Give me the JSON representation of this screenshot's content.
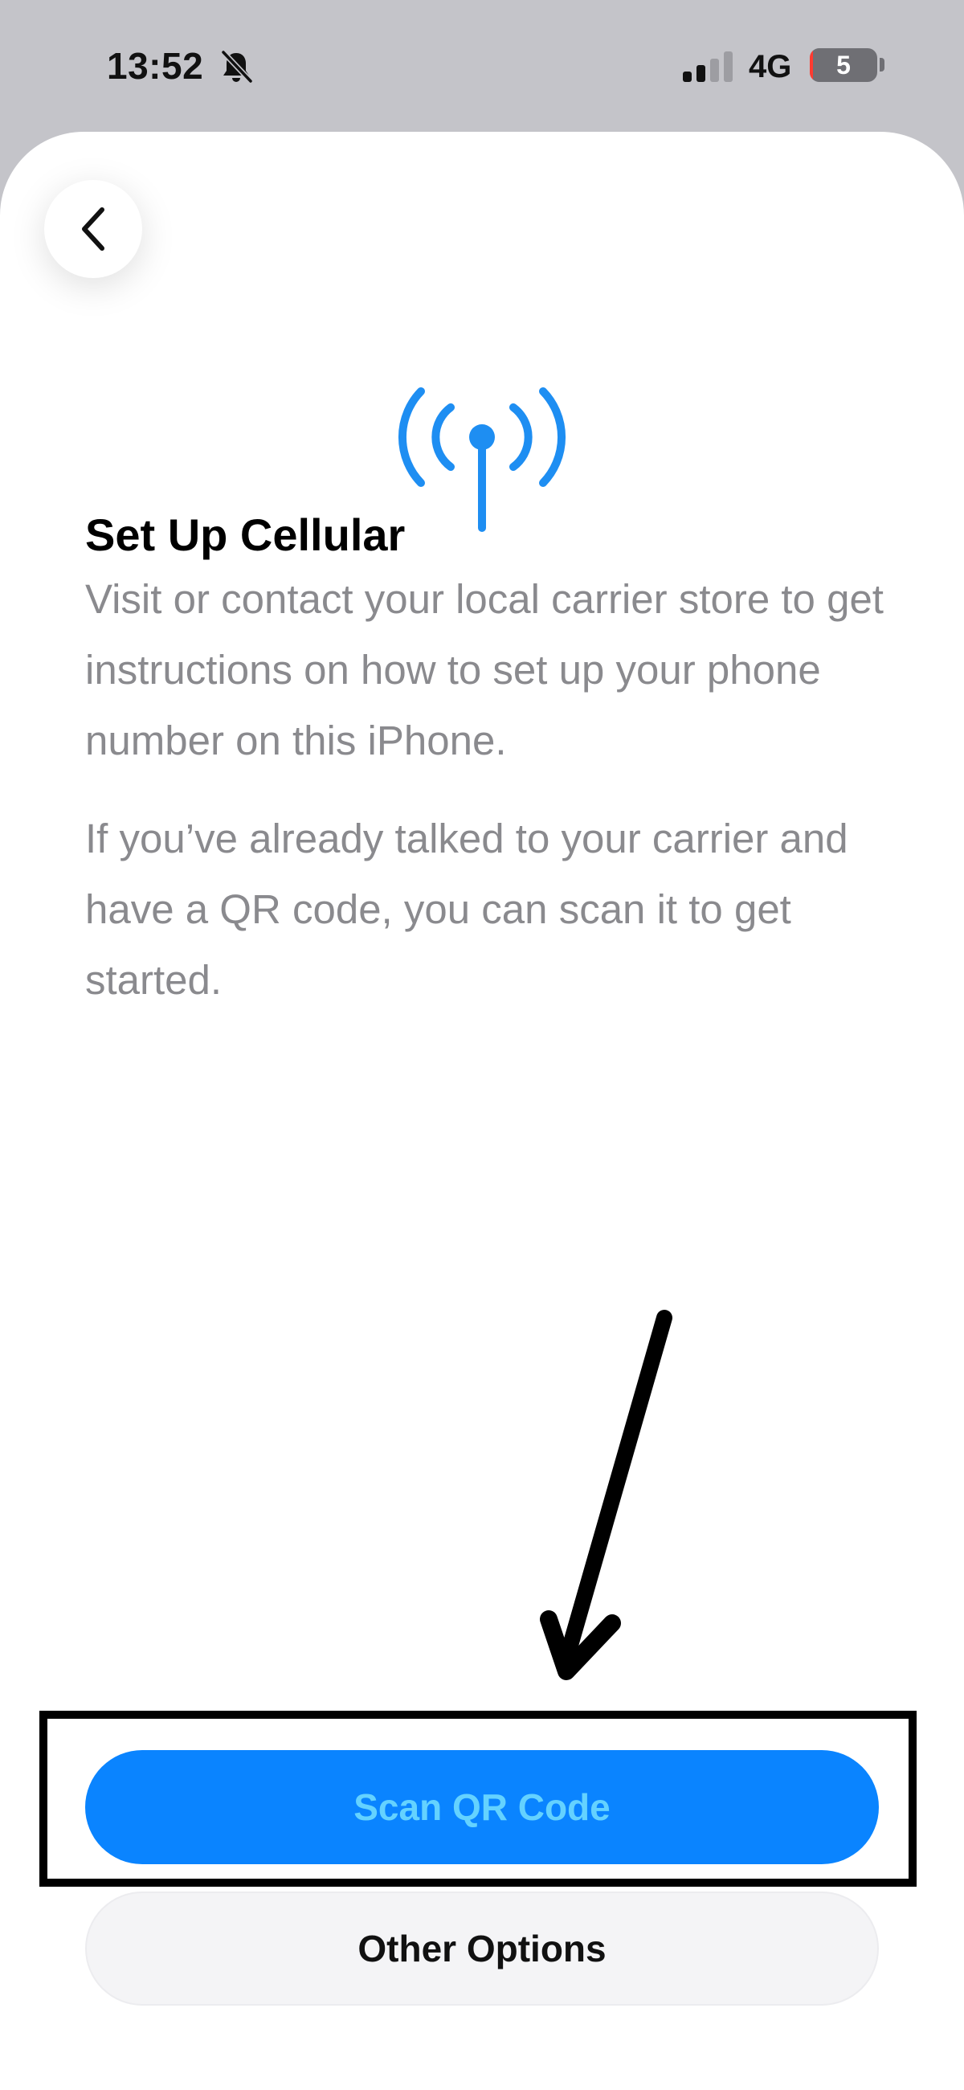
{
  "status_bar": {
    "time": "13:52",
    "network": "4G",
    "battery_level": "5",
    "battery_fraction": 0.05,
    "signal_bars_active": 2,
    "signal_bars_total": 4
  },
  "setup": {
    "title": "Set Up Cellular",
    "description_1": "Visit or contact your local carrier store to get instructions on how to set up your phone number on this iPhone.",
    "description_2": "If you’ve already talked to your carrier and have a QR code, you can scan it to get started."
  },
  "actions": {
    "scan_label": "Scan QR Code",
    "other_label": "Other Options"
  },
  "icons": {
    "back": "chevron-left-icon",
    "hero": "antenna-icon",
    "silent": "bell-slash-icon",
    "signal": "cellular-signal-icon"
  },
  "colors": {
    "accent": "#0a84ff",
    "accent_text": "#64d2ff",
    "hero_icon": "#1e8ef2",
    "body_text": "#8a8a8e",
    "battery_low": "#ff3b30"
  }
}
